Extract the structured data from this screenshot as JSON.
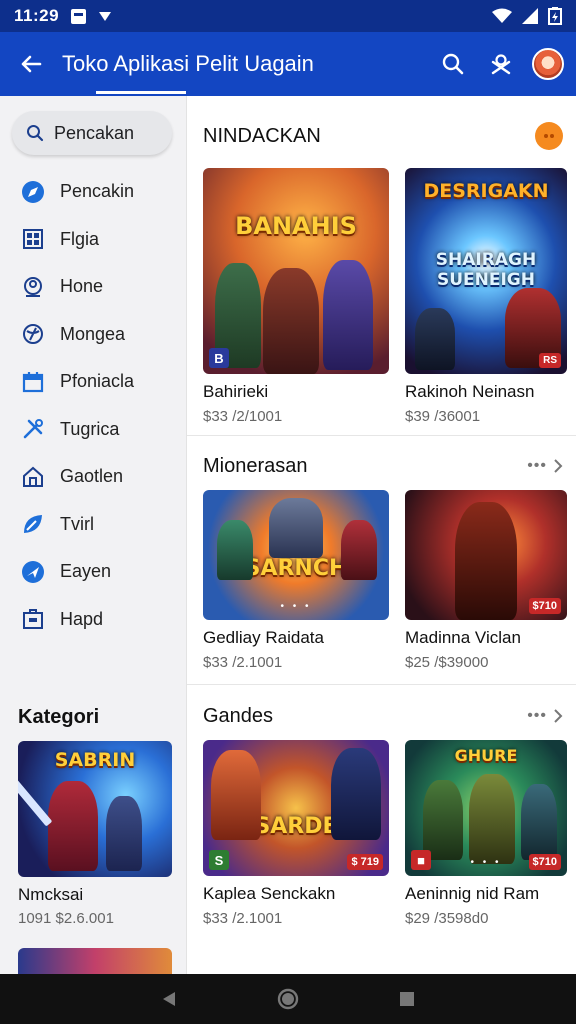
{
  "status_bar": {
    "time": "11:29"
  },
  "app_bar": {
    "title": "Toko Aplikasi Pelit Uagain"
  },
  "sidebar": {
    "search_label": "Pencakan",
    "items": [
      {
        "label": "Pencakin",
        "icon": "compass-icon"
      },
      {
        "label": "Flgia",
        "icon": "grid-icon"
      },
      {
        "label": "Hone",
        "icon": "person-icon"
      },
      {
        "label": "Mongea",
        "icon": "globe-icon"
      },
      {
        "label": "Pfoniacla",
        "icon": "calendar-icon"
      },
      {
        "label": "Tugrica",
        "icon": "tools-icon"
      },
      {
        "label": "Gaotlen",
        "icon": "home-icon"
      },
      {
        "label": "Tvirl",
        "icon": "leaf-icon"
      },
      {
        "label": "Eayen",
        "icon": "navigation-icon"
      },
      {
        "label": "Hapd",
        "icon": "briefcase-icon"
      }
    ],
    "category_title": "Kategori",
    "category_card": {
      "name": "Nmcksai",
      "sub": "1091 $2.6.001",
      "thumb_text": "SABRIN"
    }
  },
  "sections": [
    {
      "title": "NINDACKAN",
      "cards": [
        {
          "name": "Bahirieki",
          "price": "$33 /2/1001",
          "thumb_text": "BANAHIS",
          "badge": "",
          "pager": ""
        },
        {
          "name": "Rakinoh Neinasn",
          "price": "$39 /36001",
          "thumb_text": "DESRIGAKN",
          "thumb_text2": "SHAIRAGH SUENEIGH",
          "badge": "",
          "pager": ""
        }
      ]
    },
    {
      "title": "Mionerasan",
      "cards": [
        {
          "name": "Gedliay Raidata",
          "price": "$33 /2.1001",
          "thumb_text": "SARNCH",
          "badge": "",
          "pager": "• • •"
        },
        {
          "name": "Madinna Viclan",
          "price": "$25 /$39000",
          "thumb_text": "",
          "badge": "$710",
          "pager": ""
        }
      ]
    },
    {
      "title": "Gandes",
      "cards": [
        {
          "name": "Kaplea Senckakn",
          "price": "$33 /2.1001",
          "thumb_text": "SARDE",
          "badge": "$ 719",
          "pager": ""
        },
        {
          "name": "Aeninnig nid Ram",
          "price": "$29 /3598d0",
          "thumb_text": "GHURE",
          "badge": "$710",
          "pager": "• • •"
        }
      ]
    }
  ],
  "colors": {
    "status": "#0d2f8c",
    "appbar": "#1346c2",
    "accent_orange": "#f58a1f"
  }
}
